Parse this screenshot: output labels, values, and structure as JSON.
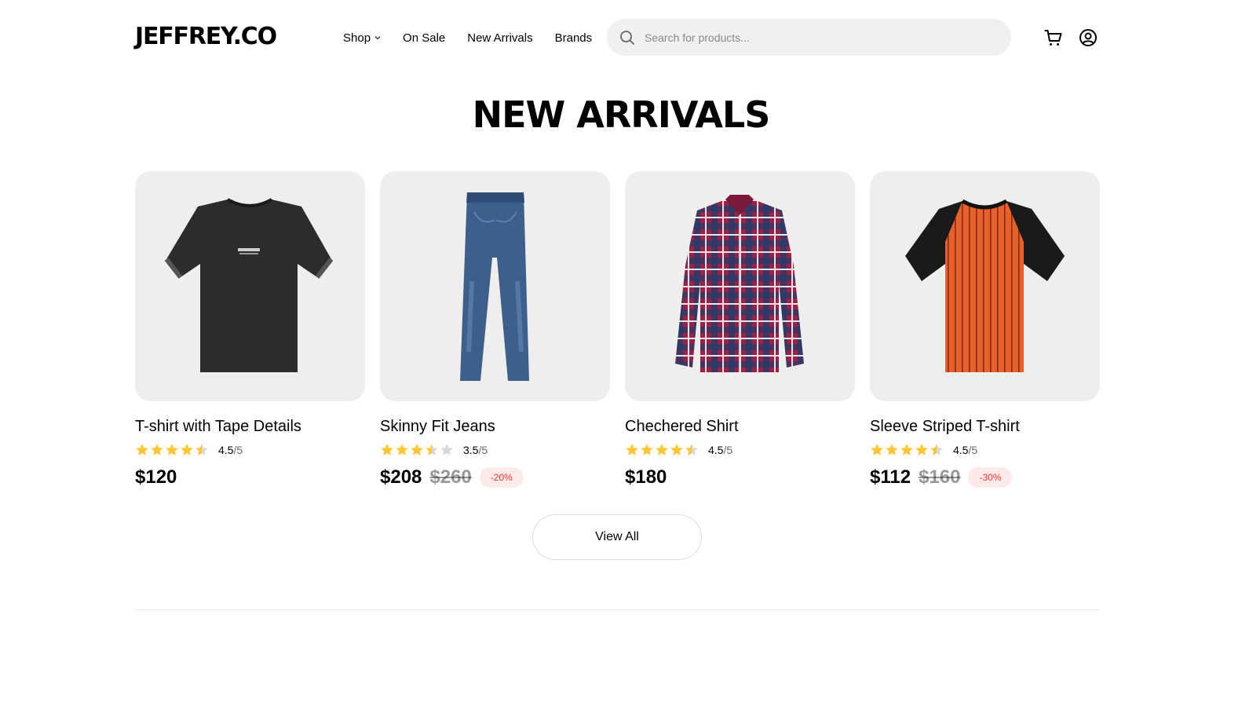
{
  "header": {
    "logo": "JEFFREY.CO",
    "nav": [
      {
        "label": "Shop",
        "has_dropdown": true
      },
      {
        "label": "On Sale",
        "has_dropdown": false
      },
      {
        "label": "New Arrivals",
        "has_dropdown": false
      },
      {
        "label": "Brands",
        "has_dropdown": false
      }
    ],
    "search": {
      "placeholder": "Search for products...",
      "value": "",
      "icon": "search-icon"
    },
    "icons": [
      "cart-icon",
      "account-icon"
    ]
  },
  "section": {
    "title": "NEW ARRIVALS",
    "view_all_label": "View All"
  },
  "products": [
    {
      "name": "T-shirt with Tape Details",
      "rating": 4.5,
      "rating_value": "4.5",
      "rating_max": "/5",
      "price": "$120",
      "old_price": "",
      "discount": "",
      "image": "black-tshirt-image"
    },
    {
      "name": "Skinny Fit Jeans",
      "rating": 3.5,
      "rating_value": "3.5",
      "rating_max": "/5",
      "price": "$208",
      "old_price": "$260",
      "discount": "-20%",
      "image": "blue-jeans-image"
    },
    {
      "name": "Chechered Shirt",
      "rating": 4.5,
      "rating_value": "4.5",
      "rating_max": "/5",
      "price": "$180",
      "old_price": "",
      "discount": "",
      "image": "plaid-shirt-image"
    },
    {
      "name": "Sleeve Striped T-shirt",
      "rating": 4.5,
      "rating_value": "4.5",
      "rating_max": "/5",
      "price": "$112",
      "old_price": "$160",
      "discount": "-30%",
      "image": "striped-tshirt-image"
    }
  ],
  "colors": {
    "star": "#FFC633",
    "star_empty": "#d9d9d9",
    "discount_text": "#FF3333",
    "card_bg": "#F0EEED",
    "search_bg": "#F0F0F0"
  }
}
